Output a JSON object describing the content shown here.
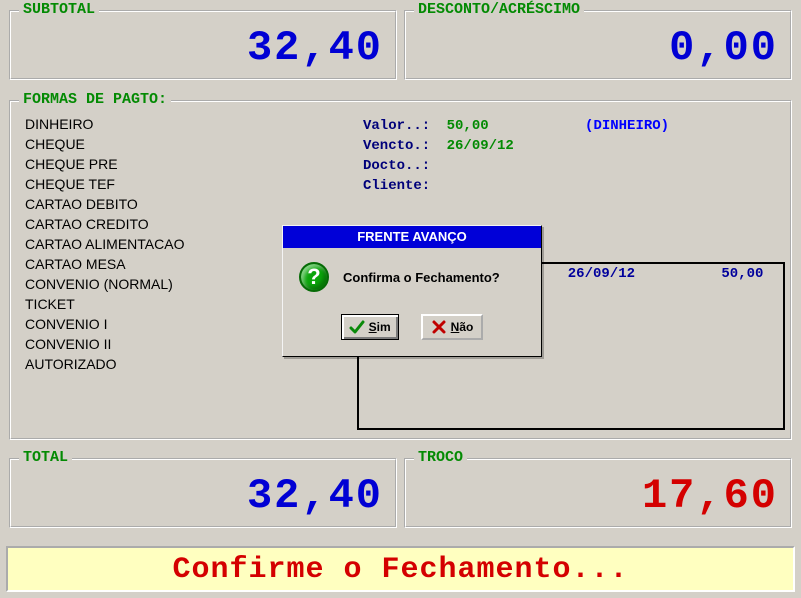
{
  "panels": {
    "subtotal": {
      "title": "SUBTOTAL",
      "value": "32,40"
    },
    "discount": {
      "title": "DESCONTO/ACRÉSCIMO",
      "value": "0,00"
    },
    "payment": {
      "title": "FORMAS DE PAGTO:"
    },
    "total": {
      "title": "TOTAL",
      "value": "32,40"
    },
    "change": {
      "title": "TROCO",
      "value": "17,60"
    }
  },
  "payment_methods": [
    "DINHEIRO",
    "CHEQUE",
    "CHEQUE PRE",
    "CHEQUE TEF",
    "CARTAO DEBITO",
    "CARTAO CREDITO",
    "CARTAO ALIMENTACAO",
    "CARTAO MESA",
    "CONVENIO (NORMAL)",
    "TICKET",
    "CONVENIO I",
    "CONVENIO II",
    "AUTORIZADO"
  ],
  "detail": {
    "labels": {
      "valor": "Valor..:",
      "vencto": "Vencto.:",
      "docto": "Docto..:",
      "cliente": "Cliente:"
    },
    "valor": "50,00",
    "vencto": "26/09/12",
    "method": "(DINHEIRO)",
    "docto": "",
    "cliente": ""
  },
  "entries": [
    {
      "date": "26/09/12",
      "amount": "50,00"
    }
  ],
  "status": "Confirme o Fechamento...",
  "dialog": {
    "title": "FRENTE AVANÇO",
    "message": "Confirma o Fechamento?",
    "yes": "Sim",
    "no": "Não"
  }
}
